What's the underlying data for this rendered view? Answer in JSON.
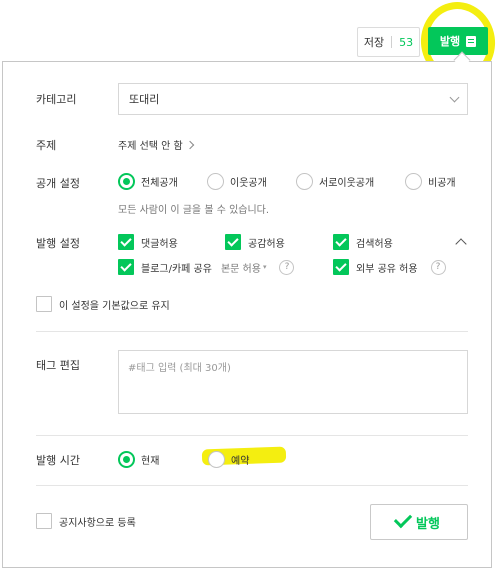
{
  "topbar": {
    "save_label": "저장",
    "save_count": "53",
    "publish_label": "발행"
  },
  "category": {
    "label": "카테고리",
    "value": "또대리"
  },
  "topic": {
    "label": "주제",
    "value": "주제 선택 안 함"
  },
  "visibility": {
    "label": "공개 설정",
    "options": [
      "전체공개",
      "이웃공개",
      "서로이웃공개",
      "비공개"
    ],
    "selected": "전체공개",
    "hint": "모든 사람이 이 글을 볼 수 있습니다."
  },
  "publish_settings": {
    "label": "발행 설정",
    "comments": "댓글허용",
    "likes": "공감허용",
    "search": "검색허용",
    "blog_cafe_share": "블로그/카페 공유",
    "share_option": "본문 허용",
    "external_share": "외부 공유 허용",
    "help": "?"
  },
  "keep_default": {
    "label": "이 설정을 기본값으로 유지"
  },
  "tags": {
    "label": "태그 편집",
    "placeholder": "#태그 입력 (최대 30개)"
  },
  "publish_time": {
    "label": "발행 시간",
    "now": "현재",
    "reserve": "예약",
    "selected": "현재"
  },
  "notice": {
    "label": "공지사항으로 등록"
  },
  "publish_button": {
    "label": "발행"
  },
  "colors": {
    "accent": "#03c75a",
    "highlight": "#f4ee10"
  }
}
